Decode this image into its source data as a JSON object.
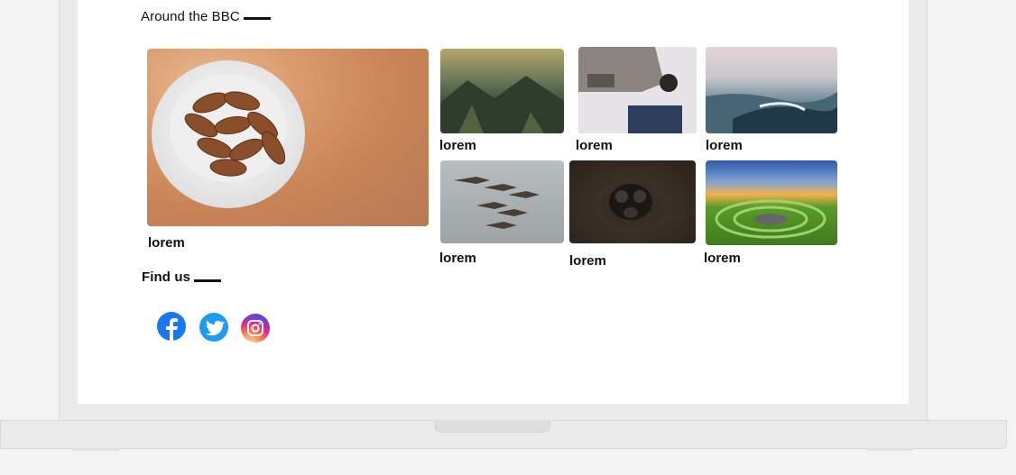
{
  "sections": {
    "around": {
      "title": "Around the BBC"
    },
    "find_us": {
      "title": "Find us"
    }
  },
  "cards": [
    {
      "caption": "lorem",
      "image": "almonds-bowl"
    },
    {
      "caption": "lorem",
      "image": "mountain-valley"
    },
    {
      "caption": "lorem",
      "image": "ruined-building"
    },
    {
      "caption": "lorem",
      "image": "ocean-wave"
    },
    {
      "caption": "lorem",
      "image": "fighter-jets"
    },
    {
      "caption": "lorem",
      "image": "gas-mask"
    },
    {
      "caption": "lorem",
      "image": "green-spiral-field"
    }
  ],
  "social": [
    {
      "name": "facebook-icon",
      "color": "#1877f2"
    },
    {
      "name": "twitter-icon",
      "color": "#1d9bf0"
    },
    {
      "name": "instagram-icon",
      "color": "#c13584"
    }
  ]
}
